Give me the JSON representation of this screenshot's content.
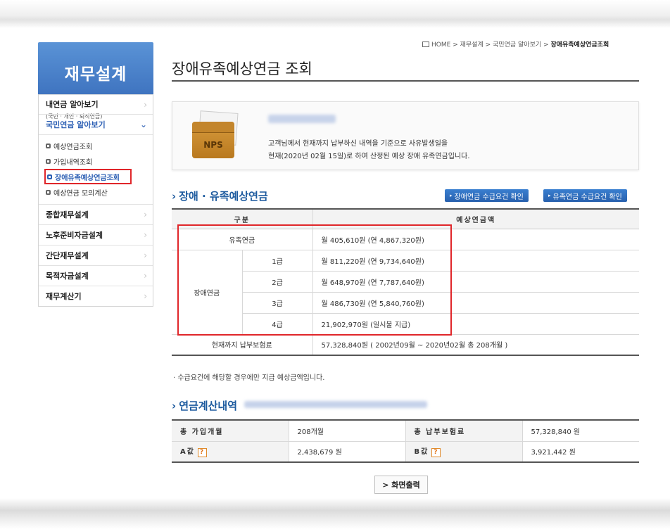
{
  "sidebar": {
    "title": "재무설계",
    "items": [
      {
        "label": "내연금 알아보기",
        "sub": "(국민 · 개인 · 퇴직연금)"
      },
      {
        "label": "국민연금 알아보기"
      },
      {
        "label": "종합재무설계"
      },
      {
        "label": "노후준비자금설계"
      },
      {
        "label": "간단재무설계"
      },
      {
        "label": "목적자금설계"
      },
      {
        "label": "재무계산기"
      }
    ],
    "sub_items": [
      "예상연금조회",
      "가입내역조회",
      "장애유족예상연금조회",
      "예상연금 모의계산"
    ]
  },
  "breadcrumb": {
    "home": "HOME",
    "sep": ">",
    "b1": "재무설계",
    "b2": "국민연금 알아보기",
    "current": "장애유족예상연금조회"
  },
  "page_title": "장애유족예상연금 조회",
  "info": {
    "logo_text": "NPS",
    "line1": "고객님께서 현재까지 납부하신 내역을 기준으로 사유발생일을",
    "line2": "현재(2020년 02월 15일)로 하여 산정된 예상 장애 유족연금입니다."
  },
  "section1": {
    "title": "장애 · 유족예상연금",
    "btn_disability": "장애연금 수급요건 확인",
    "btn_survivor": "유족연금 수급요건 확인"
  },
  "table": {
    "col_kind": "구분",
    "col_amount": "예상연금액",
    "survivor_label": "유족연금",
    "survivor_amount": "월 405,610원 (연 4,867,320원)",
    "disability_label": "장애연금",
    "grades": [
      {
        "grade": "1급",
        "amount": "월 811,220원 (연 9,734,640원)"
      },
      {
        "grade": "2급",
        "amount": "월 648,970원 (연 7,787,640원)"
      },
      {
        "grade": "3급",
        "amount": "월 486,730원 (연 5,840,760원)"
      },
      {
        "grade": "4급",
        "amount": "21,902,970원 (일시불 지급)"
      }
    ],
    "paid_label": "현재까지 납부보험료",
    "paid_amount": "57,328,840원 ( 2002년09월 ~ 2020년02월 총 208개월 )"
  },
  "note": "· 수급요건에 해당할 경우에만 지급 예상금액입니다.",
  "section2": {
    "title": "연금계산내역"
  },
  "calc": {
    "total_months_label": "총 가입개월",
    "total_months_value": "208개월",
    "total_paid_label": "총 납부보험료",
    "total_paid_value": "57,328,840 원",
    "a_label": "A값",
    "a_value": "2,438,679 원",
    "b_label": "B값",
    "b_value": "3,921,442 원",
    "help": "?"
  },
  "print_button": "> 화면출력",
  "chevron": "›"
}
